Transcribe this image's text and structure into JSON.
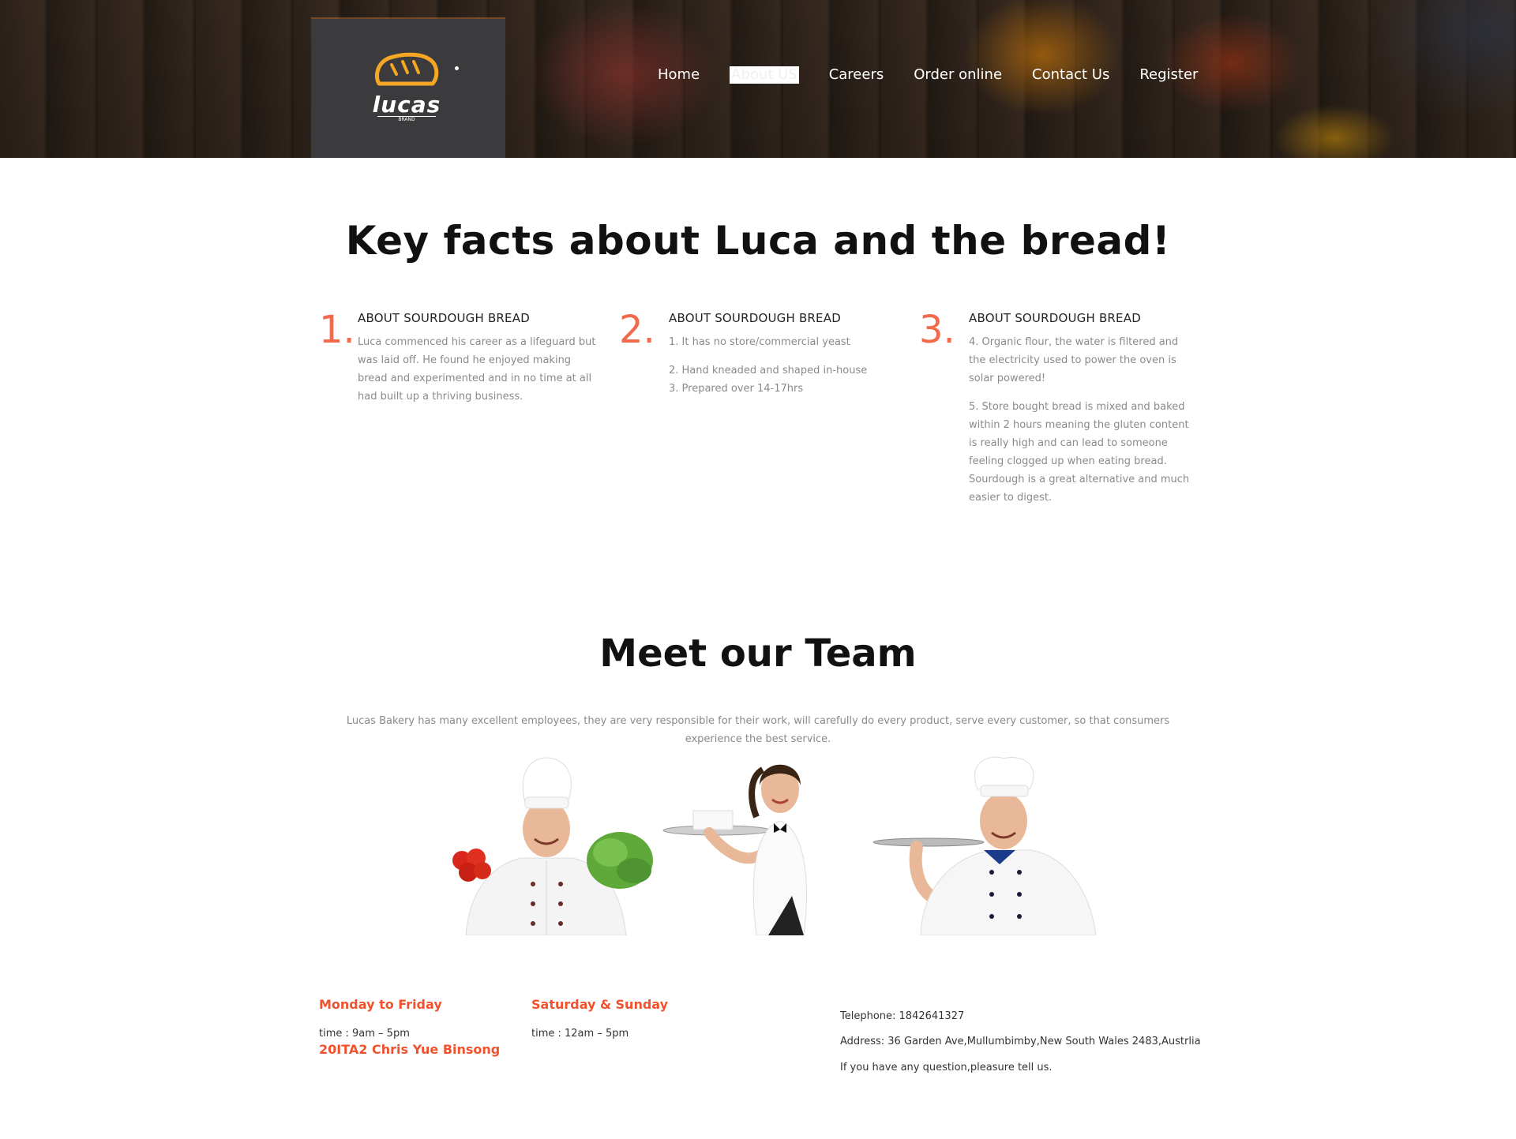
{
  "brand": {
    "name": "lucas",
    "tagline": "BRAND"
  },
  "colors": {
    "accent": "#f26a4b",
    "footer_heading": "#f0522e",
    "header_box": "#3b3b3d",
    "logo_orange": "#f5a623"
  },
  "nav": {
    "items": [
      {
        "label": "Home"
      },
      {
        "label": "About US",
        "active": true
      },
      {
        "label": "Careers"
      },
      {
        "label": "Order online"
      },
      {
        "label": "Contact Us"
      },
      {
        "label": "Register"
      }
    ]
  },
  "facts": {
    "title": "Key facts about Luca and the bread!",
    "items": [
      {
        "number": "1.",
        "heading": "ABOUT SOURDOUGH BREAD",
        "paragraphs": [
          "Luca commenced his career as a lifeguard but was laid off. He found he enjoyed making bread and experimented and in no time at all had built up a thriving business."
        ]
      },
      {
        "number": "2.",
        "heading": "ABOUT SOURDOUGH BREAD",
        "paragraphs": [
          "1. It has no store/commercial yeast",
          "2. Hand kneaded and shaped in-house",
          "3. Prepared over 14-17hrs"
        ]
      },
      {
        "number": "3.",
        "heading": "ABOUT SOURDOUGH BREAD",
        "paragraphs": [
          "4. Organic flour, the water is filtered and the electricity used to power the oven is solar powered!",
          "5. Store bought bread is mixed and baked within 2 hours meaning the gluten content is really high and can lead to someone feeling clogged up when eating bread. Sourdough is a great alternative and much easier to digest."
        ]
      }
    ]
  },
  "team": {
    "title": "Meet our Team",
    "description": "Lucas Bakery has many excellent employees, they are very responsible for their work, will carefully do every product, serve every customer, so that consumers experience the best service."
  },
  "footer": {
    "weekday_heading": "Monday to Friday",
    "weekday_time": "time : 9am – 5pm",
    "credit": "20ITA2 Chris Yue Binsong",
    "weekend_heading": "Saturday & Sunday",
    "weekend_time": "time : 12am – 5pm",
    "telephone": "Telephone: 1842641327",
    "address": "Address: 36 Garden Ave,Mullumbimby,New South Wales 2483,Austrlia",
    "question": "If you have any question,pleasure tell us."
  }
}
